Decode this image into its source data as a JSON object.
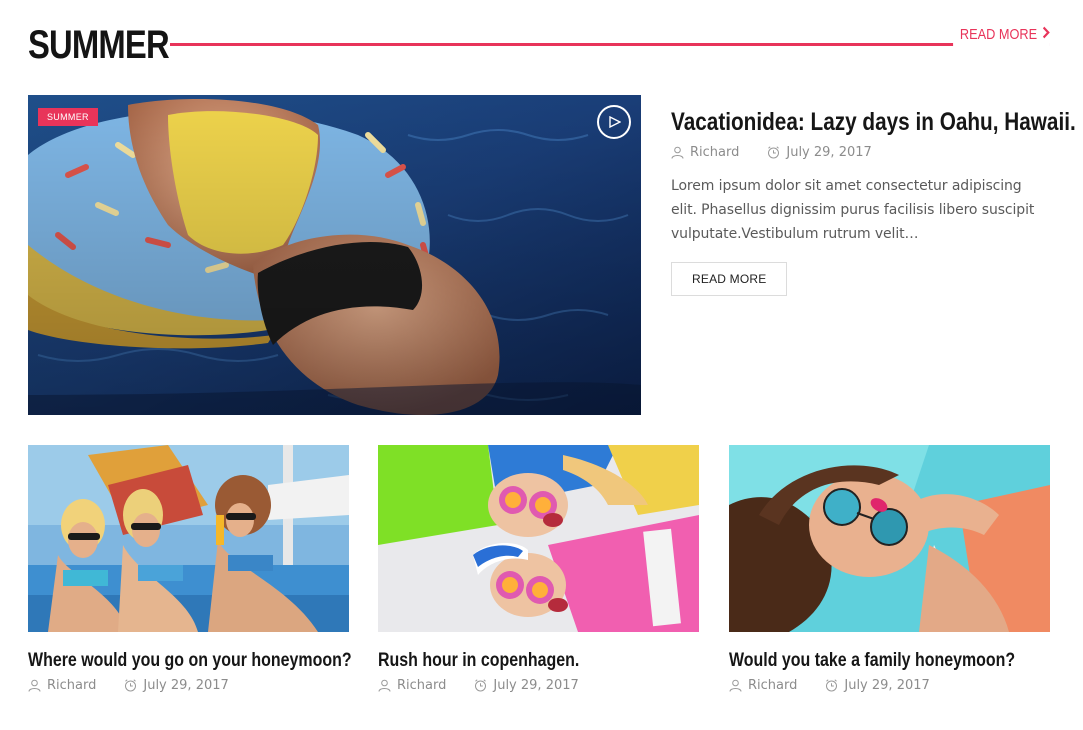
{
  "section": {
    "title": "SUMMER",
    "read_more_label": "READ MORE",
    "accent_color": "#e8345a"
  },
  "featured": {
    "category": "SUMMER",
    "title": "Vacationidea: Lazy days in Oahu, Hawaii.",
    "author": "Richard",
    "date": "July 29, 2017",
    "excerpt": "Lorem ipsum dolor sit amet consectetur adipiscing elit. Phasellus dignissim purus facilisis libero suscipit vulputate.Vestibulum rutrum velit…",
    "button_label": "READ MORE",
    "image_icon": "play-icon"
  },
  "cards": [
    {
      "title": "Where would you go on your honeymoon?",
      "author": "Richard",
      "date": "July 29, 2017"
    },
    {
      "title": "Rush hour in copenhagen.",
      "author": "Richard",
      "date": "July 29, 2017"
    },
    {
      "title": "Would you take a family honeymoon?",
      "author": "Richard",
      "date": "July 29, 2017"
    }
  ]
}
